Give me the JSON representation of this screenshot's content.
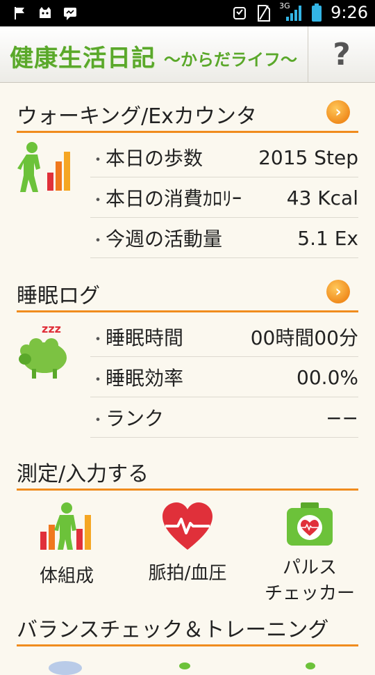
{
  "status": {
    "time": "9:26",
    "network": "3G"
  },
  "app": {
    "title": "健康生活日記",
    "subtitle": "〜からだライフ〜",
    "help_label": "?"
  },
  "walking": {
    "title": "ウォーキング/Exカウンタ",
    "rows": [
      {
        "label": "本日の歩数",
        "value": "2015 Step"
      },
      {
        "label": "本日の消費ｶﾛﾘｰ",
        "value": "43 Kcal"
      },
      {
        "label": "今週の活動量",
        "value": "5.1 Ex"
      }
    ]
  },
  "sleep": {
    "title": "睡眠ログ",
    "rows": [
      {
        "label": "睡眠時間",
        "value": "00時間00分"
      },
      {
        "label": "睡眠効率",
        "value": "00.0%"
      },
      {
        "label": "ランク",
        "value": "−−"
      }
    ],
    "zzz": "zzz"
  },
  "measure": {
    "title": "測定/入力する",
    "tiles": [
      {
        "label": "体組成"
      },
      {
        "label": "脈拍/血圧"
      },
      {
        "label_line1": "パルス",
        "label_line2": "チェッカー"
      }
    ]
  },
  "balance": {
    "title": "バランスチェック＆トレーニング"
  },
  "colors": {
    "accent": "#f08c1e",
    "brand_green": "#5aa82a",
    "heart_red": "#e0303a",
    "background": "#fbf8ef"
  }
}
